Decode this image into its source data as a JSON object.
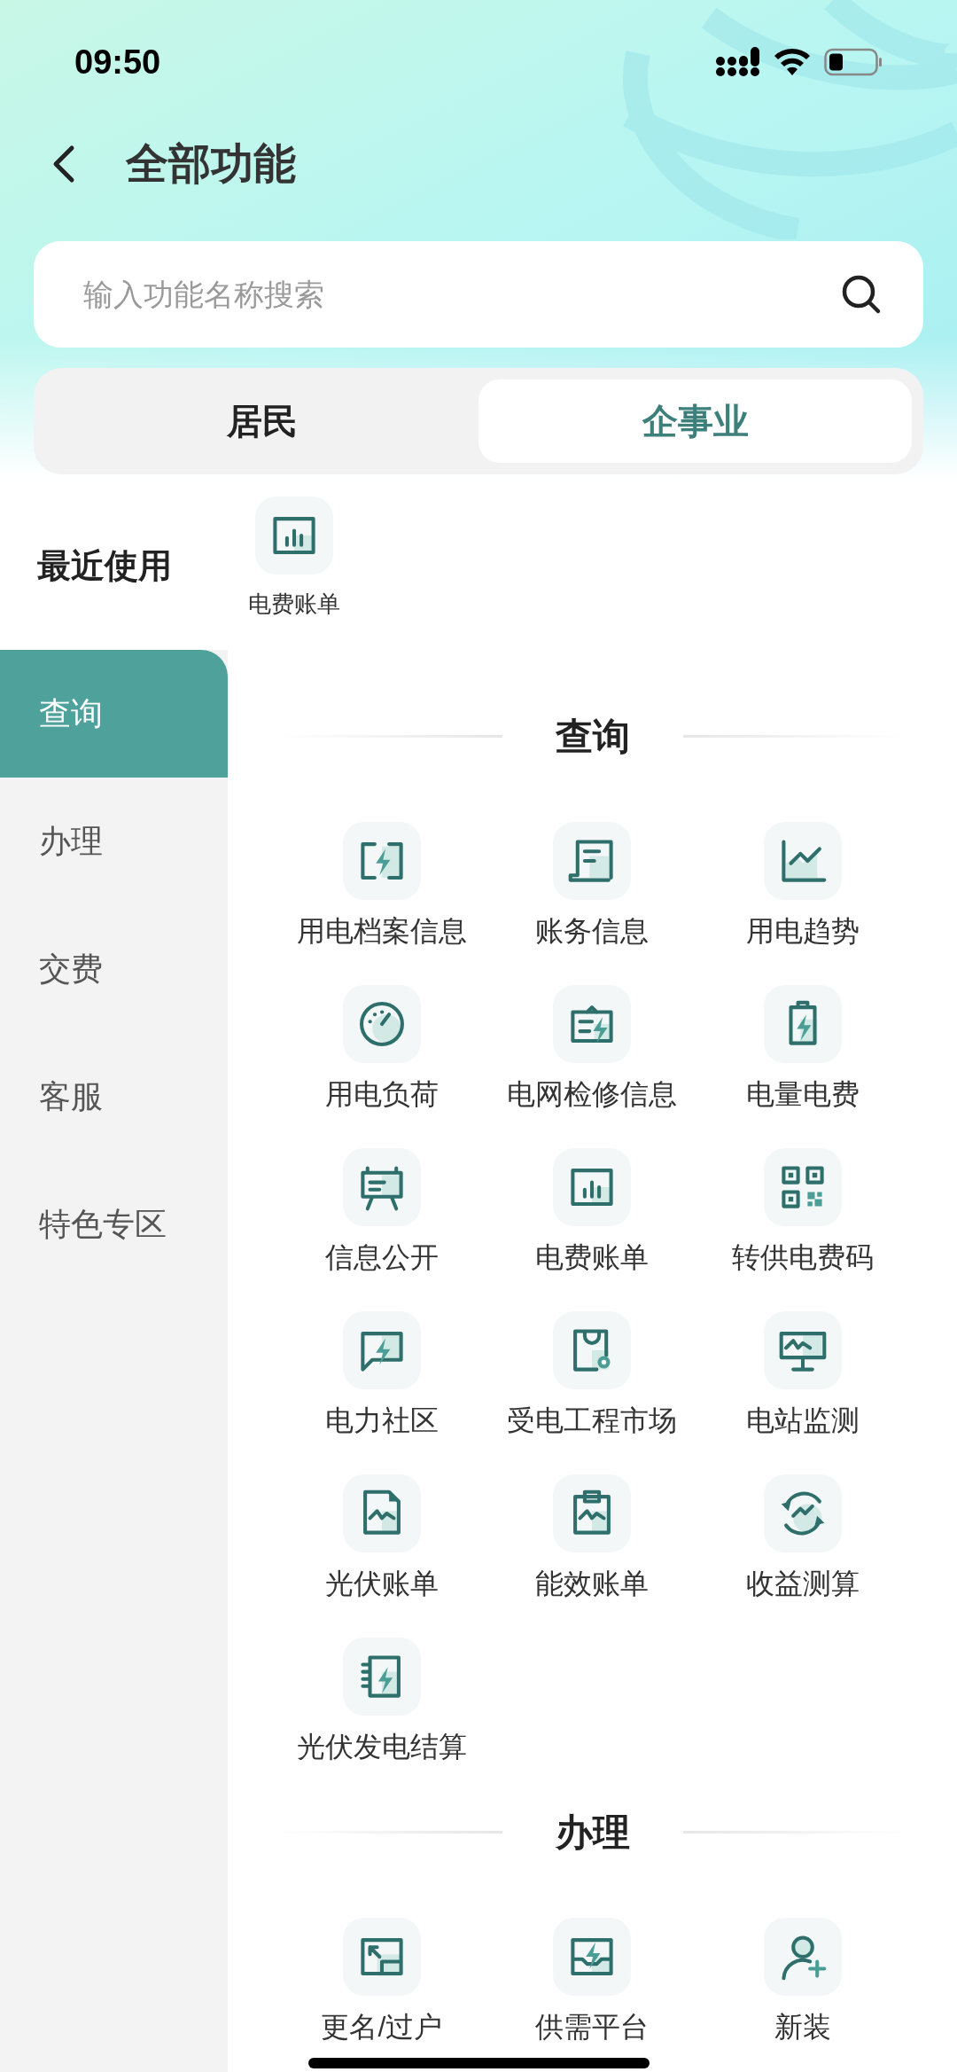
{
  "status_bar": {
    "time": "09:50"
  },
  "header": {
    "title": "全部功能"
  },
  "search": {
    "placeholder": "输入功能名称搜索"
  },
  "tabs": [
    {
      "label": "居民",
      "selected": false
    },
    {
      "label": "企事业",
      "selected": true
    }
  ],
  "recent": {
    "title": "最近使用",
    "items": [
      {
        "label": "电费账单"
      }
    ]
  },
  "sidebar": {
    "items": [
      {
        "label": "查询",
        "selected": true
      },
      {
        "label": "办理",
        "selected": false
      },
      {
        "label": "交费",
        "selected": false
      },
      {
        "label": "客服",
        "selected": false
      },
      {
        "label": "特色专区",
        "selected": false
      }
    ]
  },
  "sections": [
    {
      "title": "查询",
      "items": [
        {
          "label": "用电档案信息"
        },
        {
          "label": "账务信息"
        },
        {
          "label": "用电趋势"
        },
        {
          "label": "用电负荷"
        },
        {
          "label": "电网检修信息"
        },
        {
          "label": "电量电费"
        },
        {
          "label": "信息公开"
        },
        {
          "label": "电费账单"
        },
        {
          "label": "转供电费码"
        },
        {
          "label": "电力社区"
        },
        {
          "label": "受电工程市场"
        },
        {
          "label": "电站监测"
        },
        {
          "label": "光伏账单"
        },
        {
          "label": "能效账单"
        },
        {
          "label": "收益测算"
        },
        {
          "label": "光伏发电结算"
        }
      ]
    },
    {
      "title": "办理",
      "items": [
        {
          "label": "更名/过户"
        },
        {
          "label": "供需平台"
        },
        {
          "label": "新装"
        }
      ]
    }
  ]
}
